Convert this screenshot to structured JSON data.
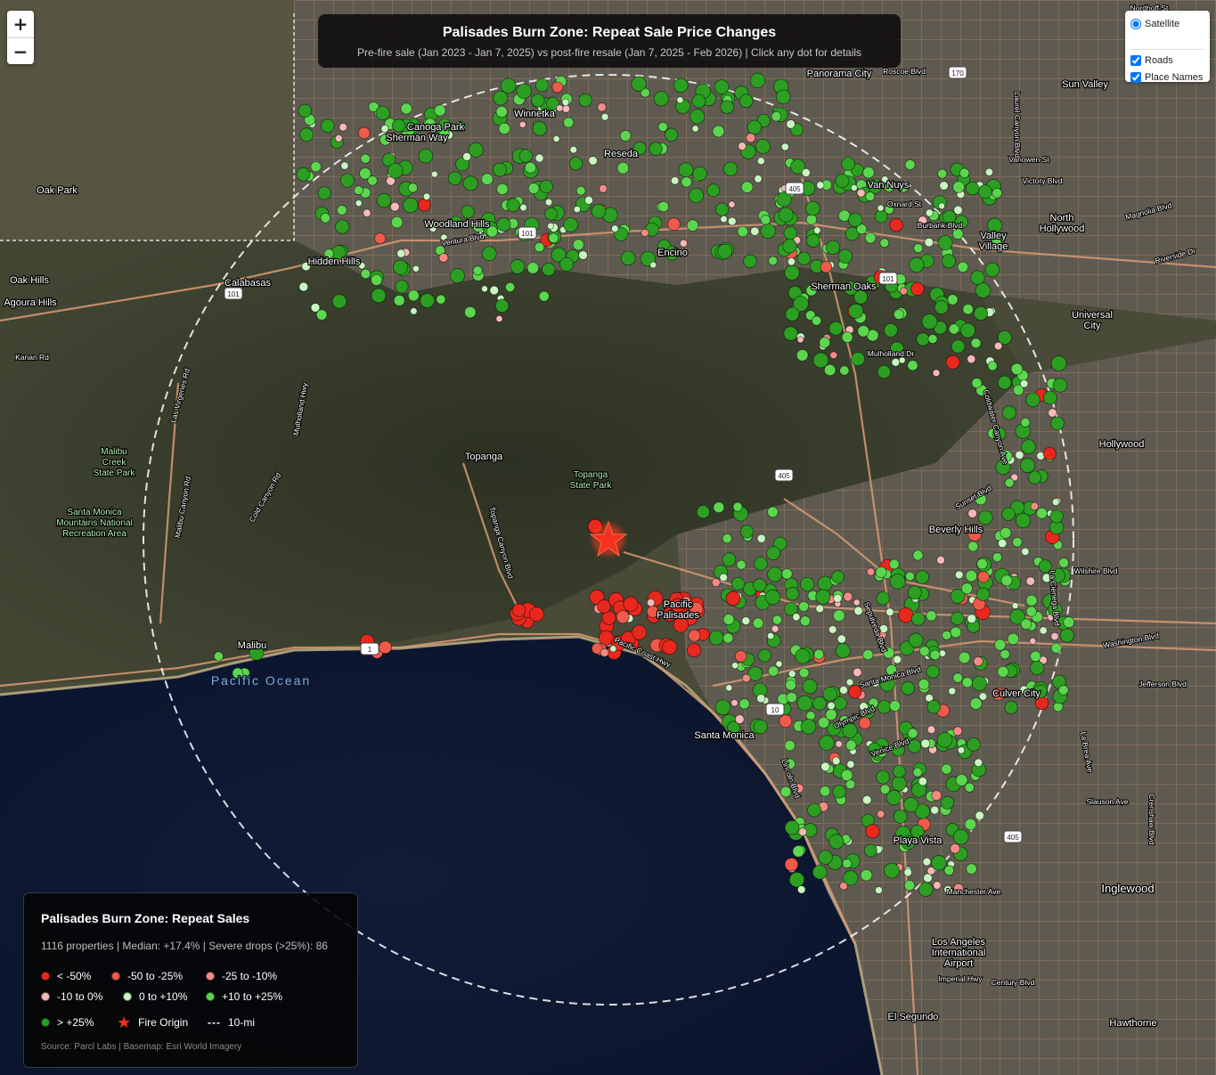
{
  "map": {
    "title": "Palisades Burn Zone: Repeat Sale Price Changes",
    "subtitle": "Pre-fire sale (Jan 2023 - Jan 7, 2025) vs post-fire resale (Jan 7, 2025 - Feb 2026) | Click any dot for details",
    "zoom_in": "+",
    "zoom_out": "−"
  },
  "layers": {
    "satellite": "Satellite",
    "roads": "Roads",
    "place_names": "Place Names",
    "satellite_on": true,
    "roads_on": true,
    "place_names_on": true
  },
  "legend": {
    "title": "Palisades Burn Zone: Repeat Sales",
    "stats": "1116 properties | Median: +17.4% | Severe drops (>25%): 86",
    "items": [
      {
        "label": "< -50%",
        "color": "#e8281e",
        "icon": "dot"
      },
      {
        "label": "-50 to -25%",
        "color": "#ef5a4a",
        "icon": "dot"
      },
      {
        "label": "-25 to -10%",
        "color": "#f28b86",
        "icon": "dot"
      },
      {
        "label": "-10 to 0%",
        "color": "#f7b8b8",
        "icon": "dot"
      },
      {
        "label": "0 to +10%",
        "color": "#c8f5c0",
        "icon": "dot"
      },
      {
        "label": "+10 to +25%",
        "color": "#5cd64f",
        "icon": "dot"
      },
      {
        "label": "> +25%",
        "color": "#2c9e22",
        "icon": "dot"
      },
      {
        "label": "Fire Origin",
        "color": "#f5301e",
        "icon": "star-icon"
      },
      {
        "label": "10-mi",
        "color": "#ffffff",
        "icon": "dash"
      }
    ],
    "source": "Source: Parcl Labs | Basemap: Esri World Imagery"
  },
  "places": [
    {
      "name": "Canoga Park",
      "size": "normal"
    },
    {
      "name": "Winnetka",
      "size": "normal"
    },
    {
      "name": "Reseda",
      "size": "normal"
    },
    {
      "name": "Sherman Way",
      "size": "normal"
    },
    {
      "name": "Van Nuys",
      "size": "normal"
    },
    {
      "name": "Panorama City",
      "size": "normal"
    },
    {
      "name": "Sun Valley",
      "size": "normal"
    },
    {
      "name": "North Hollywood",
      "size": "normal"
    },
    {
      "name": "Valley Village",
      "size": "normal"
    },
    {
      "name": "Woodland Hills",
      "size": "normal"
    },
    {
      "name": "Hidden Hills",
      "size": "normal"
    },
    {
      "name": "Calabasas",
      "size": "normal"
    },
    {
      "name": "Agoura Hills",
      "size": "normal"
    },
    {
      "name": "Oak Park",
      "size": "normal"
    },
    {
      "name": "Oak Hills",
      "size": "normal"
    },
    {
      "name": "Encino",
      "size": "normal"
    },
    {
      "name": "Sherman Oaks",
      "size": "normal"
    },
    {
      "name": "Universal City",
      "size": "normal"
    },
    {
      "name": "Hollywood",
      "size": "normal"
    },
    {
      "name": "Topanga",
      "size": "normal"
    },
    {
      "name": "Topanga State Park",
      "size": "park"
    },
    {
      "name": "Malibu Creek State Park",
      "size": "park"
    },
    {
      "name": "Santa Monica Mountains National Recreation Area",
      "size": "park"
    },
    {
      "name": "Beverly Hills",
      "size": "normal"
    },
    {
      "name": "Malibu",
      "size": "normal"
    },
    {
      "name": "Pacific Palisades",
      "size": "normal"
    },
    {
      "name": "Santa Monica",
      "size": "normal"
    },
    {
      "name": "Culver City",
      "size": "normal"
    },
    {
      "name": "Playa Vista",
      "size": "normal"
    },
    {
      "name": "Inglewood",
      "size": "big"
    },
    {
      "name": "Los Angeles International Airport",
      "size": "normal"
    },
    {
      "name": "El Segundo",
      "size": "normal"
    },
    {
      "name": "Hawthorne",
      "size": "normal"
    },
    {
      "name": "Pacific Ocean",
      "size": "ocean"
    }
  ],
  "roads": [
    "Ventura Blvd",
    "Mulholland Dr",
    "Mulholland Hwy",
    "Sunset Blvd",
    "Santa Monica Blvd",
    "Wilshire Blvd",
    "Pacific Coast Hwy",
    "Olympic Blvd",
    "Venice Blvd",
    "Topanga Canyon Blvd",
    "Sepulveda Blvd",
    "Lincoln Blvd",
    "Victory Blvd",
    "Vanowen St",
    "Roscoe Blvd",
    "Nordhoff St",
    "Oxnard St",
    "Burbank Blvd",
    "Magnolia Blvd",
    "Riverside Dr",
    "Washington Blvd",
    "Jefferson Blvd",
    "Century Blvd",
    "Manchester Ave",
    "Slauson Ave",
    "Coldwater Canyon Ave",
    "Laurel Canyon Blvd",
    "La Cienega Blvd",
    "Sepulveda Blvd",
    "La Brea Ave",
    "Crenshaw Blvd",
    "Imperial Hwy",
    "Las Virgenes Rd",
    "Kanan Rd",
    "Malibu Canyon Rd",
    "Cold Canyon Rd"
  ],
  "highway_shields": [
    "101",
    "405",
    "170",
    "10",
    "1"
  ]
}
